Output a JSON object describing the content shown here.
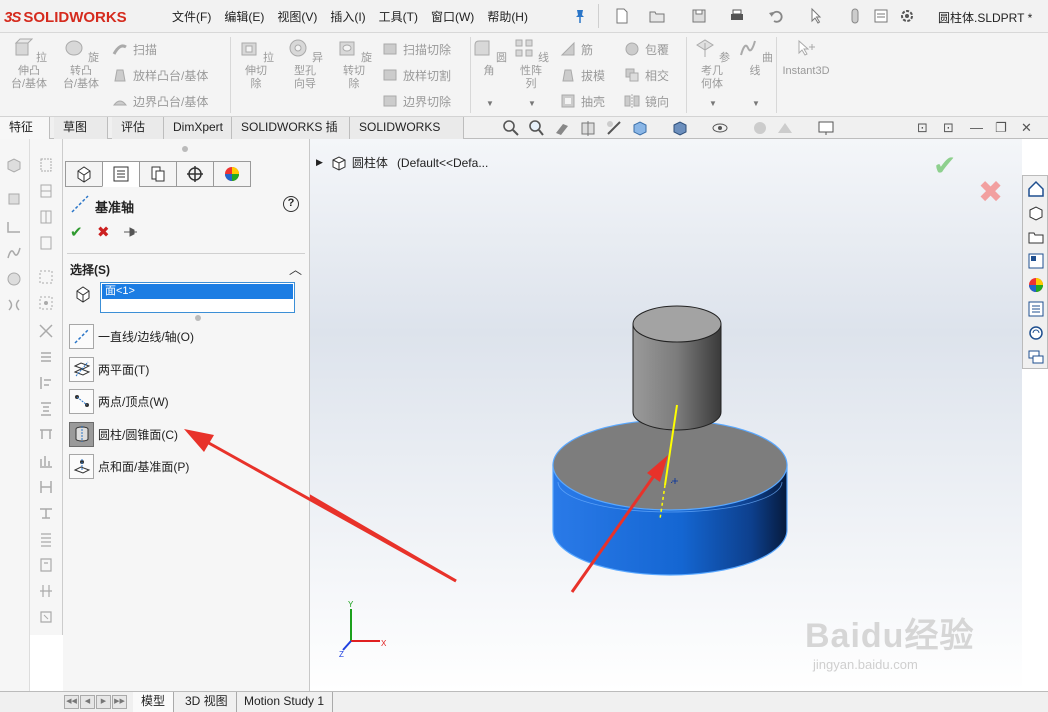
{
  "app": {
    "logo_brand": "SOLIDWORKS",
    "document_title": "圆柱体.SLDPRT *"
  },
  "menu": {
    "items": [
      "文件(F)",
      "编辑(E)",
      "视图(V)",
      "插入(I)",
      "工具(T)",
      "窗口(W)",
      "帮助(H)"
    ]
  },
  "commands": {
    "extrude_boss": "拉伸凸\n台/基体",
    "revolve_boss": "旋转凸\n台/基体",
    "sweep": "扫描",
    "loft_boss": "放样凸台/基体",
    "boundary_boss": "边界凸台/基体",
    "extrude_cut": "拉伸切\n除",
    "hole_wizard": "异型孔\n向导",
    "revolve_cut": "旋转切\n除",
    "swept_cut": "扫描切除",
    "lofted_cut": "放样切割",
    "boundary_cut": "边界切除",
    "fillet": "圆角",
    "linear_pattern": "线性阵\n列",
    "rib": "筋",
    "draft": "拔模",
    "shell": "抽壳",
    "wrap": "包覆",
    "intersect": "相交",
    "mirror": "镜向",
    "ref_geometry": "参考几\n何体",
    "curves": "曲线",
    "instant3d": "Instant3D"
  },
  "tabs": [
    "特征",
    "草图",
    "评估",
    "DimXpert",
    "SOLIDWORKS 插件",
    "SOLIDWORKS MBD"
  ],
  "property_manager": {
    "title": "基准轴",
    "section_selection": "选择(S)",
    "selected_item": "面<1>",
    "options": [
      "一直线/边线/轴(O)",
      "两平面(T)",
      "两点/顶点(W)",
      "圆柱/圆锥面(C)",
      "点和面/基准面(P)"
    ],
    "active_option_index": 3
  },
  "feature_tree": {
    "root_label": "圆柱体",
    "config_label": "(Default<<Defa..."
  },
  "triad": {
    "x_label": "X",
    "y_label": "Y",
    "z_label": "Z"
  },
  "bottom_tabs": [
    "模型",
    "3D 视图",
    "Motion Study 1"
  ],
  "watermark": {
    "brand": "Baidu经验",
    "url": "jingyan.baidu.com"
  },
  "colors": {
    "accent_blue": "#1c7de3",
    "cylinder_blue": "#1466d2",
    "axis_yellow": "#ffff00",
    "arrow_red": "#e8322a",
    "brand_red": "#d52b1e"
  }
}
